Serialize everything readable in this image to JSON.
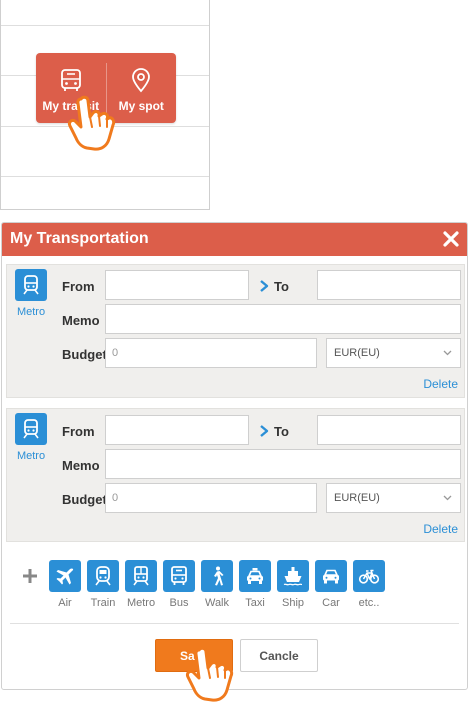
{
  "popup": {
    "transit_label": "My transit",
    "spot_label": "My spot"
  },
  "dialog": {
    "title": "My Transportation",
    "entries": [
      {
        "mode_label": "Metro",
        "from_label": "From",
        "to_label": "To",
        "memo_label": "Memo",
        "budget_label": "Budget",
        "from_value": "",
        "to_value": "",
        "memo_value": "",
        "budget_value": "0",
        "currency": "EUR(EU)",
        "delete_label": "Delete"
      },
      {
        "mode_label": "Metro",
        "from_label": "From",
        "to_label": "To",
        "memo_label": "Memo",
        "budget_label": "Budget",
        "from_value": "",
        "to_value": "",
        "memo_value": "",
        "budget_value": "0",
        "currency": "EUR(EU)",
        "delete_label": "Delete"
      }
    ],
    "modes": [
      {
        "label": "Air",
        "icon": "airplane-icon"
      },
      {
        "label": "Train",
        "icon": "train-icon"
      },
      {
        "label": "Metro",
        "icon": "metro-icon"
      },
      {
        "label": "Bus",
        "icon": "bus-icon"
      },
      {
        "label": "Walk",
        "icon": "walk-icon"
      },
      {
        "label": "Taxi",
        "icon": "taxi-icon"
      },
      {
        "label": "Ship",
        "icon": "ship-icon"
      },
      {
        "label": "Car",
        "icon": "car-icon"
      },
      {
        "label": "etc..",
        "icon": "bicycle-icon"
      }
    ],
    "save_label": "Save",
    "cancel_label": "Cancle"
  },
  "colors": {
    "header": "#dc5e4a",
    "accent": "#2b8fd6",
    "save": "#f07a1d"
  }
}
